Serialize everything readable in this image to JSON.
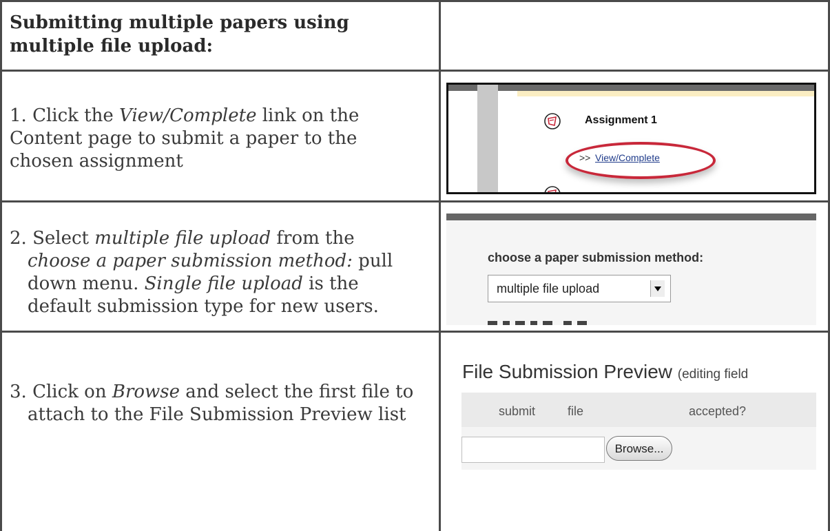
{
  "header": {
    "title": "Submitting multiple papers using multiple file upload:"
  },
  "steps": [
    {
      "number": "1.",
      "text_runs": [
        {
          "t": "Click the ",
          "i": false
        },
        {
          "t": "View/Complete",
          "i": true
        },
        {
          "t": " link on the Content page to submit a paper to the chosen assignment",
          "i": false
        }
      ],
      "screenshot": {
        "assignment_title": "Assignment 1",
        "link_prefix": ">>",
        "link_text": "View/Complete",
        "highlight_color": "#c8283a"
      }
    },
    {
      "number": "2.",
      "text_runs": [
        {
          "t": "Select ",
          "i": false
        },
        {
          "t": "multiple file upload",
          "i": true
        },
        {
          "t": " from the ",
          "i": false
        },
        {
          "t": "choose a paper submission method:",
          "i": true
        },
        {
          "t": " pull down menu. ",
          "i": false
        },
        {
          "t": "Single file upload",
          "i": true
        },
        {
          "t": " is the default submission type for new users.",
          "i": false
        }
      ],
      "screenshot": {
        "method_label": "choose a paper submission method:",
        "selected_option": "multiple file upload"
      }
    },
    {
      "number": "3.",
      "text_runs": [
        {
          "t": "Click on ",
          "i": false
        },
        {
          "t": "Browse",
          "i": true
        },
        {
          "t": " and select the first file to attach to the File Submission Preview list",
          "i": false
        }
      ],
      "screenshot": {
        "title": "File Submission Preview",
        "subtitle": "(editing field",
        "columns": [
          "submit",
          "file",
          "accepted?"
        ],
        "browse_label": "Browse..."
      }
    }
  ]
}
